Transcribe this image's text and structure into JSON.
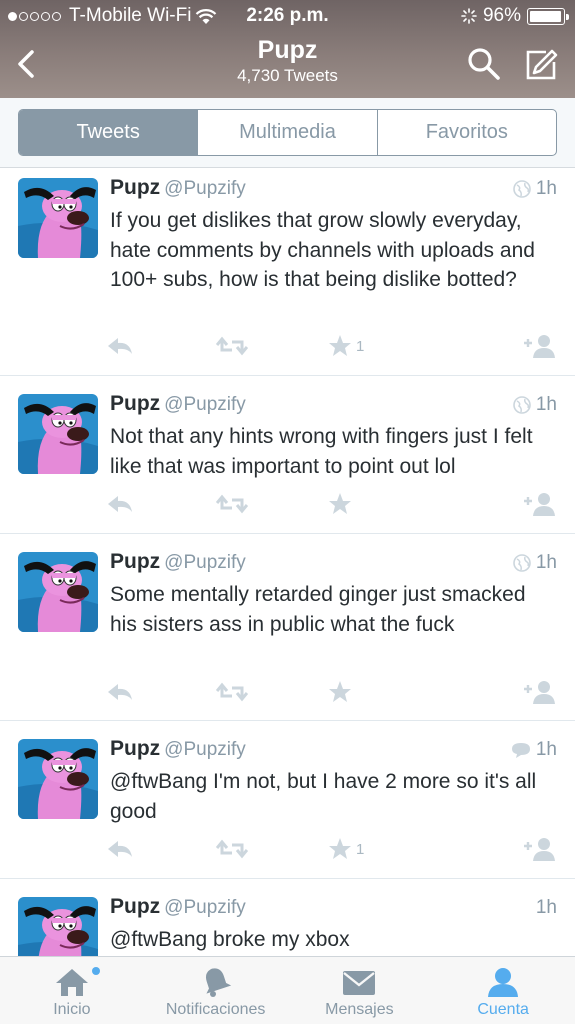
{
  "status_bar": {
    "carrier": "T-Mobile Wi-Fi",
    "time": "2:26 p.m.",
    "battery": "96%",
    "battery_level": 0.96
  },
  "nav": {
    "title": "Pupz",
    "subtitle": "4,730 Tweets"
  },
  "segments": [
    {
      "label": "Tweets",
      "active": true
    },
    {
      "label": "Multimedia",
      "active": false
    },
    {
      "label": "Favoritos",
      "active": false
    }
  ],
  "tweets": [
    {
      "name": "Pupz",
      "handle": "@Pupzify",
      "time": "1h",
      "meta_icon": "globe-icon",
      "text": "If you get dislikes that grow slowly everyday, hate comments by channels with uploads and 100+ subs, how is that being dislike botted?",
      "favorites": "1"
    },
    {
      "name": "Pupz",
      "handle": "@Pupzify",
      "time": "1h",
      "meta_icon": "globe-icon",
      "text": "Not that any hints wrong with fingers just I felt like that was important to point out lol",
      "favorites": ""
    },
    {
      "name": "Pupz",
      "handle": "@Pupzify",
      "time": "1h",
      "meta_icon": "globe-icon",
      "text": "Some mentally retarded ginger just smacked his sisters ass in public what the fuck",
      "favorites": ""
    },
    {
      "name": "Pupz",
      "handle": "@Pupzify",
      "time": "1h",
      "meta_icon": "speech-bubble-icon",
      "text": "@ftwBang I'm not, but I have 2 more so it's all good",
      "favorites": "1"
    },
    {
      "name": "Pupz",
      "handle": "@Pupzify",
      "time": "1h",
      "meta_icon": "",
      "text": "@ftwBang broke my xbox",
      "favorites": ""
    }
  ],
  "tabbar": [
    {
      "label": "Inicio",
      "icon": "home-icon",
      "active": false,
      "badge": true
    },
    {
      "label": "Notificaciones",
      "icon": "bell-icon",
      "active": false,
      "badge": false
    },
    {
      "label": "Mensajes",
      "icon": "envelope-icon",
      "active": false,
      "badge": false
    },
    {
      "label": "Cuenta",
      "icon": "person-icon",
      "active": true,
      "badge": false
    }
  ],
  "colors": {
    "accent": "#55acee",
    "muted": "#8899a6",
    "text": "#292f33",
    "header": "#7d7170"
  }
}
